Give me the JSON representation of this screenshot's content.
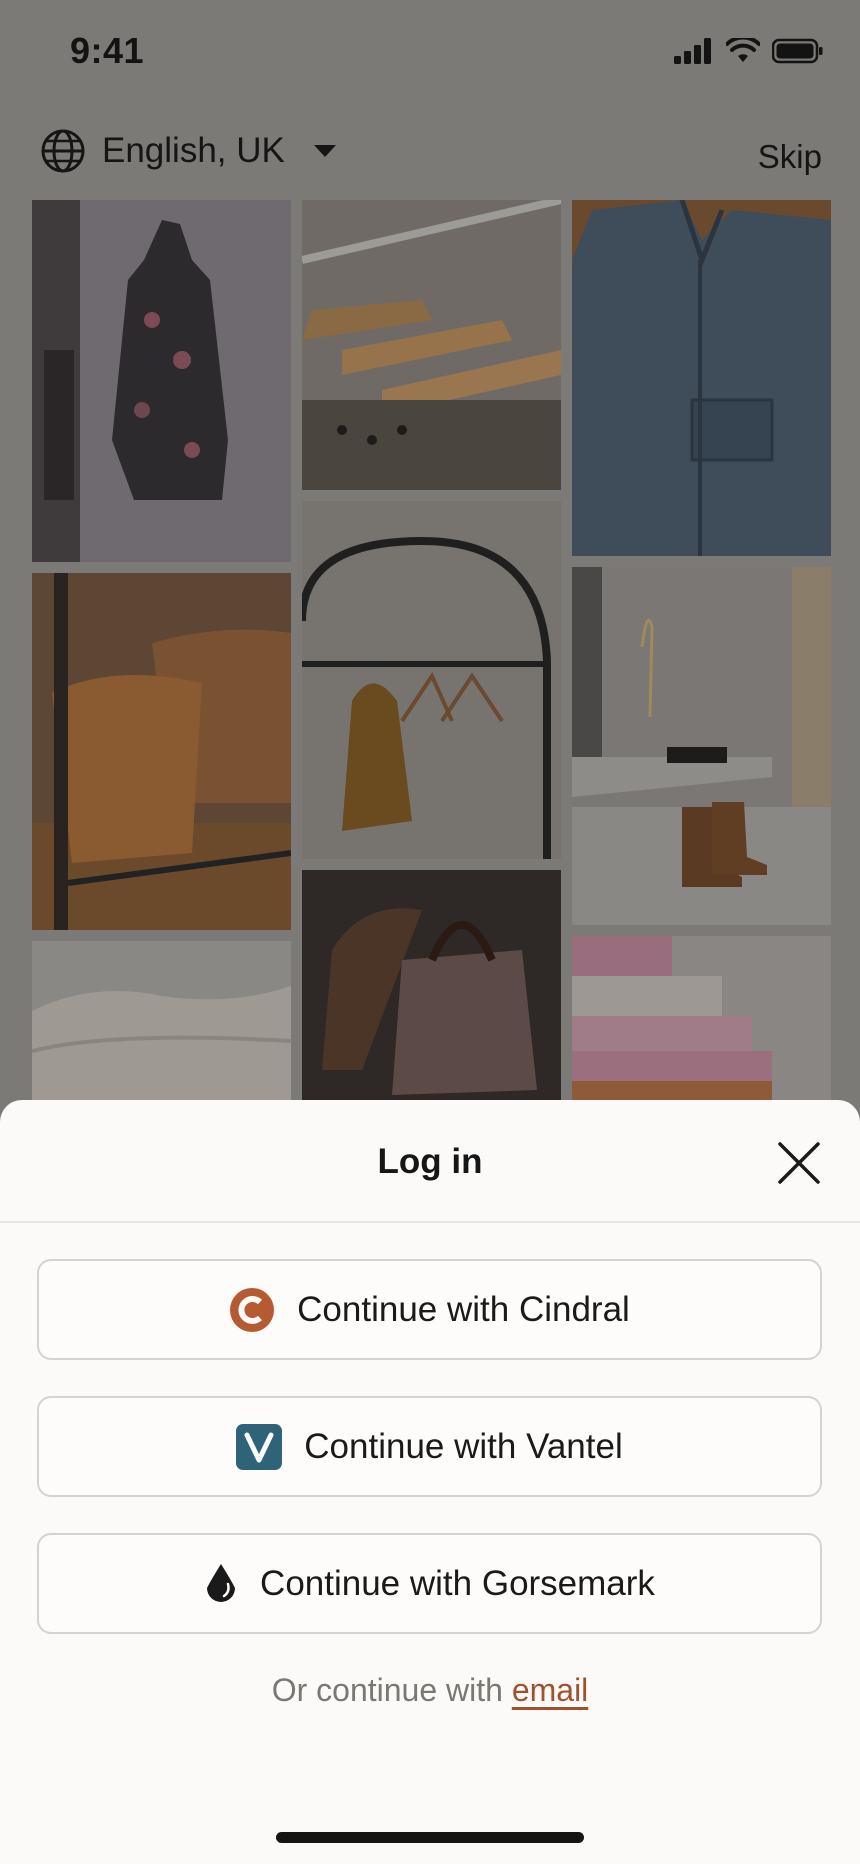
{
  "status_bar": {
    "time": "9:41"
  },
  "header": {
    "language_label": "English, UK",
    "skip_label": "Skip"
  },
  "gallery": {
    "tiles": [
      {
        "name": "floral-dress-tile",
        "color": "#4d4448"
      },
      {
        "name": "wooden-hangers-tile",
        "color": "#7a6c5c"
      },
      {
        "name": "denim-jacket-tile",
        "color": "#3f4c5a"
      },
      {
        "name": "wicker-baskets-tile",
        "color": "#5b4430"
      },
      {
        "name": "clothing-rack-tile",
        "color": "#77706a"
      },
      {
        "name": "boots-tile",
        "color": "#67625e"
      },
      {
        "name": "knit-blanket-tile",
        "color": "#8a8884"
      },
      {
        "name": "handbag-tile",
        "color": "#3a322e"
      },
      {
        "name": "folded-sweaters-tile",
        "color": "#8d7c82"
      }
    ]
  },
  "login_sheet": {
    "title": "Log in",
    "buttons": [
      {
        "label": "Continue with Cindral",
        "icon": "cindral-logo-icon",
        "color": "#b65a32"
      },
      {
        "label": "Continue with Vantel",
        "icon": "vantel-logo-icon",
        "color": "#2f6478"
      },
      {
        "label": "Continue with Gorsemark",
        "icon": "gorsemark-logo-icon",
        "color": "#1a1a1a"
      }
    ],
    "alt_prefix": "Or continue with ",
    "alt_link": "email"
  },
  "colors": {
    "accent": "#a0522d",
    "sheet_bg": "#fbfaf8"
  }
}
